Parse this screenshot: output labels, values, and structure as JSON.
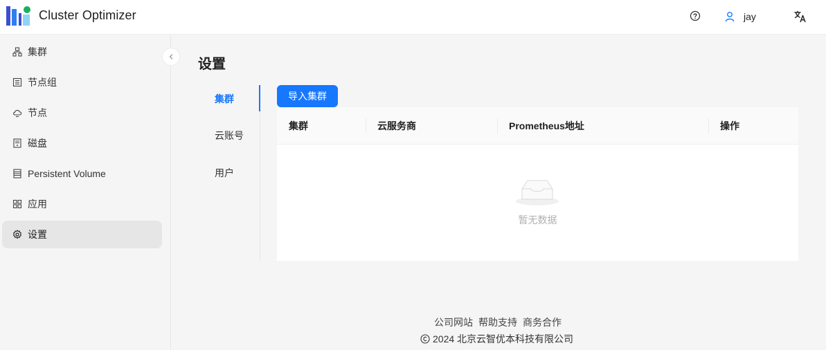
{
  "header": {
    "app_title": "Cluster Optimizer",
    "user_name": "jay",
    "help_icon": "question-circle-icon",
    "user_icon": "user-icon",
    "language_icon": "translate-icon"
  },
  "sidebar": {
    "items": [
      {
        "label": "集群",
        "icon": "cluster-icon",
        "active": false
      },
      {
        "label": "节点组",
        "icon": "node-group-icon",
        "active": false
      },
      {
        "label": "节点",
        "icon": "node-icon",
        "active": false
      },
      {
        "label": "磁盘",
        "icon": "disk-icon",
        "active": false
      },
      {
        "label": "Persistent Volume",
        "icon": "volume-icon",
        "active": false
      },
      {
        "label": "应用",
        "icon": "apps-icon",
        "active": false
      },
      {
        "label": "设置",
        "icon": "settings-icon",
        "active": true
      }
    ]
  },
  "main": {
    "page_title": "设置",
    "tabs": [
      {
        "label": "集群",
        "active": true
      },
      {
        "label": "云账号",
        "active": false
      },
      {
        "label": "用户",
        "active": false
      }
    ],
    "import_button": "导入集群",
    "table": {
      "columns": [
        "集群",
        "云服务商",
        "Prometheus地址",
        "操作"
      ],
      "rows": [],
      "empty_text": "暂无数据"
    }
  },
  "footer": {
    "links": [
      "公司网站",
      "帮助支持",
      "商务合作"
    ],
    "copyright": "2024 北京云智优本科技有限公司"
  },
  "colors": {
    "primary": "#1677ff",
    "logo_dark": "#3a4fd1",
    "logo_mid": "#2d7ff0",
    "logo_light": "#5fc2f2",
    "logo_dot": "#19b05a"
  }
}
